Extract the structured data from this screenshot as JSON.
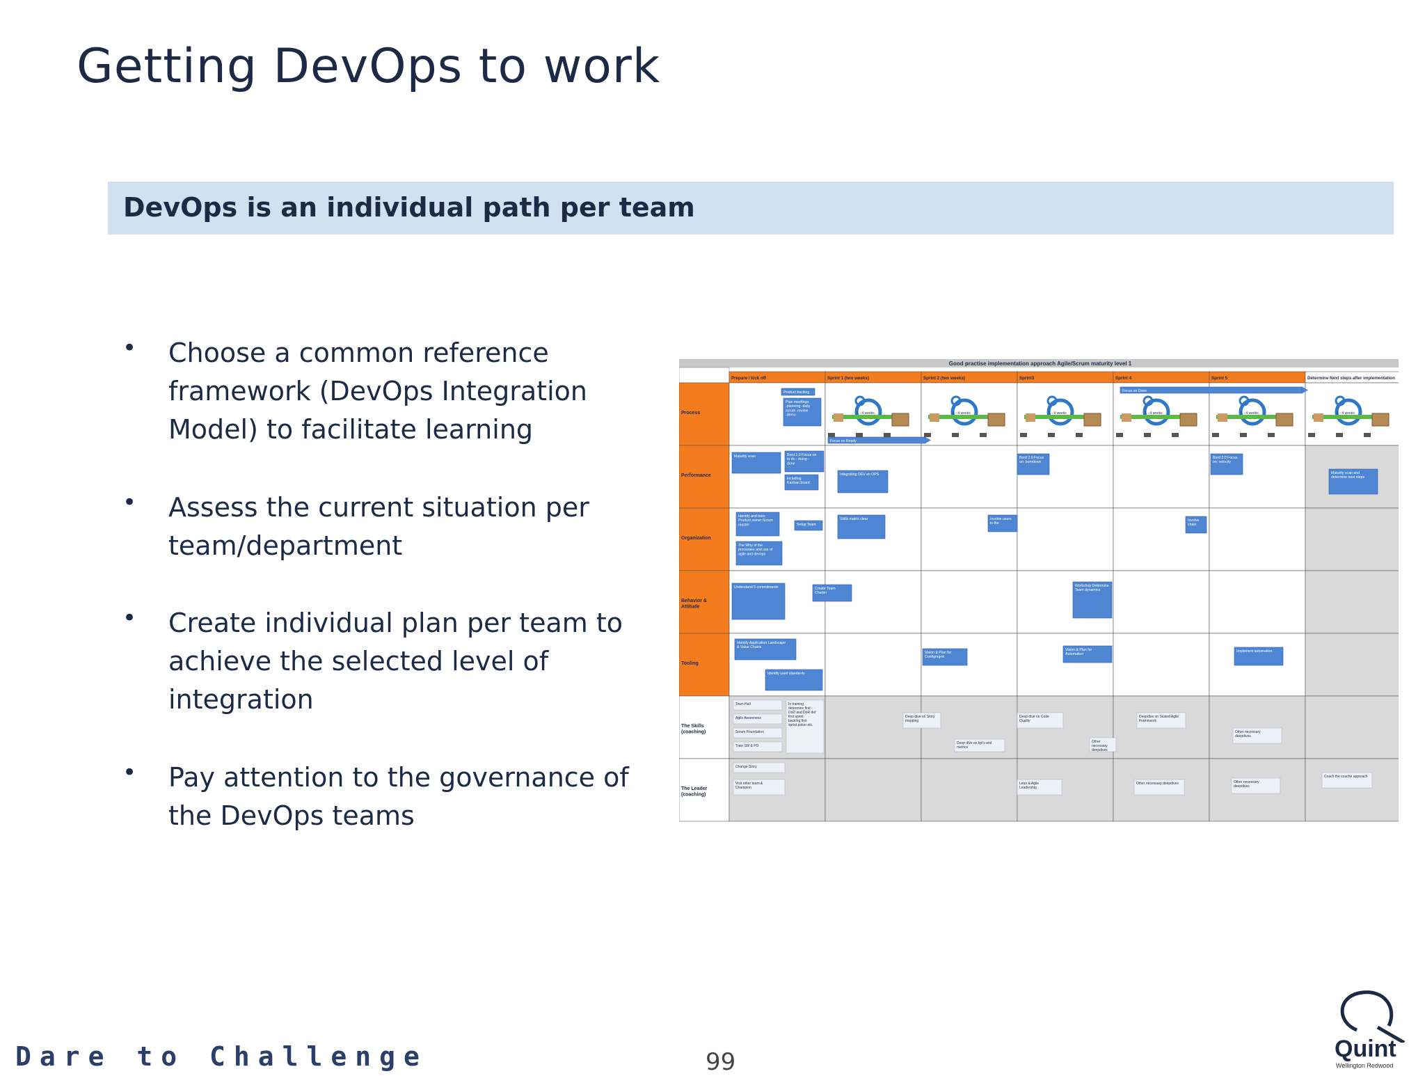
{
  "slide": {
    "title": "Getting DevOps to work",
    "banner": "DevOps is an individual path per team",
    "bullets": [
      "Choose a common reference framework (DevOps Integration Model) to facilitate learning",
      "Assess the current situation per team/department",
      "Create individual plan per team to achieve the selected level of integration",
      "Pay attention to the governance of the DevOps teams"
    ],
    "bullet_symbol": "•",
    "footer_tagline": "Dare to Challenge",
    "page_number": "99",
    "logo": {
      "name": "Quint",
      "subtitle": "Wellington Redwood"
    }
  },
  "matrix": {
    "title": "Good practise implementation approach Agile/Scrum maturity level 1",
    "columns": [
      "Prepare / kick off",
      "Sprint 1 (two weeks)",
      "Sprint 2 (two weeks)",
      "Sprint3",
      "Sprint 4",
      "Sprint 5",
      "Determine Next steps after implementation"
    ],
    "rows": [
      "Process",
      "Performance",
      "Organization",
      "Behavior & Attitude",
      "Tooling",
      "The Skills (coaching)",
      "The Leader (coaching)"
    ],
    "colors": {
      "orange": "#f47c1e",
      "blue_card": "#4f86d4",
      "grey_cell": "#d9d9d9",
      "title_bar": "#c8c8c8",
      "cycle_blue": "#2f77c8"
    },
    "cards": [
      {
        "text": "Product backlog"
      },
      {
        "text": "Plan meetings: -planning -daily scrum -review -demo"
      },
      {
        "text": "Focus on Ready"
      },
      {
        "text": "Focus on Done"
      },
      {
        "text": "Maturity scan"
      },
      {
        "text": "Bord 1.0 Focus on to do - doing - done"
      },
      {
        "text": "including Kanban board"
      },
      {
        "text": "Integrating DEV en OPS"
      },
      {
        "text": "Bord 2.0 Focus on: burndown"
      },
      {
        "text": "Bord 3.0 Focus on: velocity"
      },
      {
        "text": "Maturity scan and determine next steps"
      },
      {
        "text": "Identify and train: Product owner Scrum master"
      },
      {
        "text": "Setup Team"
      },
      {
        "text": "The Why of the processes and use of agile and devops"
      },
      {
        "text": "Skills matrix clear"
      },
      {
        "text": "Involve users in the"
      },
      {
        "text": "Involve chain"
      },
      {
        "text": "Understand 5 commitments"
      },
      {
        "text": "Create Team Charter"
      },
      {
        "text": "Workshop Determine Team dynamics"
      },
      {
        "text": "Identify Application Landscape & Value Chains"
      },
      {
        "text": "Identify used standards"
      },
      {
        "text": "Vision & Plan for Configmgmt"
      },
      {
        "text": "Vision & Plan for Automation"
      },
      {
        "text": "Implement automation"
      }
    ],
    "notes": [
      {
        "text": "Town Hall"
      },
      {
        "text": "Agile Awareness"
      },
      {
        "text": "Scrum Foundation"
      },
      {
        "text": "Train SM & PO"
      },
      {
        "text": "In training determine first DoD and DoR def first sprint backlog first sprint poker etc."
      },
      {
        "text": "Deep dive on Story mapping"
      },
      {
        "text": "Deep dive on kpi's and metrics"
      },
      {
        "text": "Deep dive on Code Quality"
      },
      {
        "text": "Other necessary deepdives"
      },
      {
        "text": "Deepdive on Scaled Agile Framework"
      },
      {
        "text": "Other necessary deepdives"
      },
      {
        "text": "Change Story"
      },
      {
        "text": "Visit other team & Champion"
      },
      {
        "text": "Lean & Agile Leadership"
      },
      {
        "text": "Other necessary deepdives"
      },
      {
        "text": "Other necessary deepdives"
      },
      {
        "text": "Coach the coache approach"
      }
    ],
    "cycle_label": "1 - 4 weeks"
  }
}
